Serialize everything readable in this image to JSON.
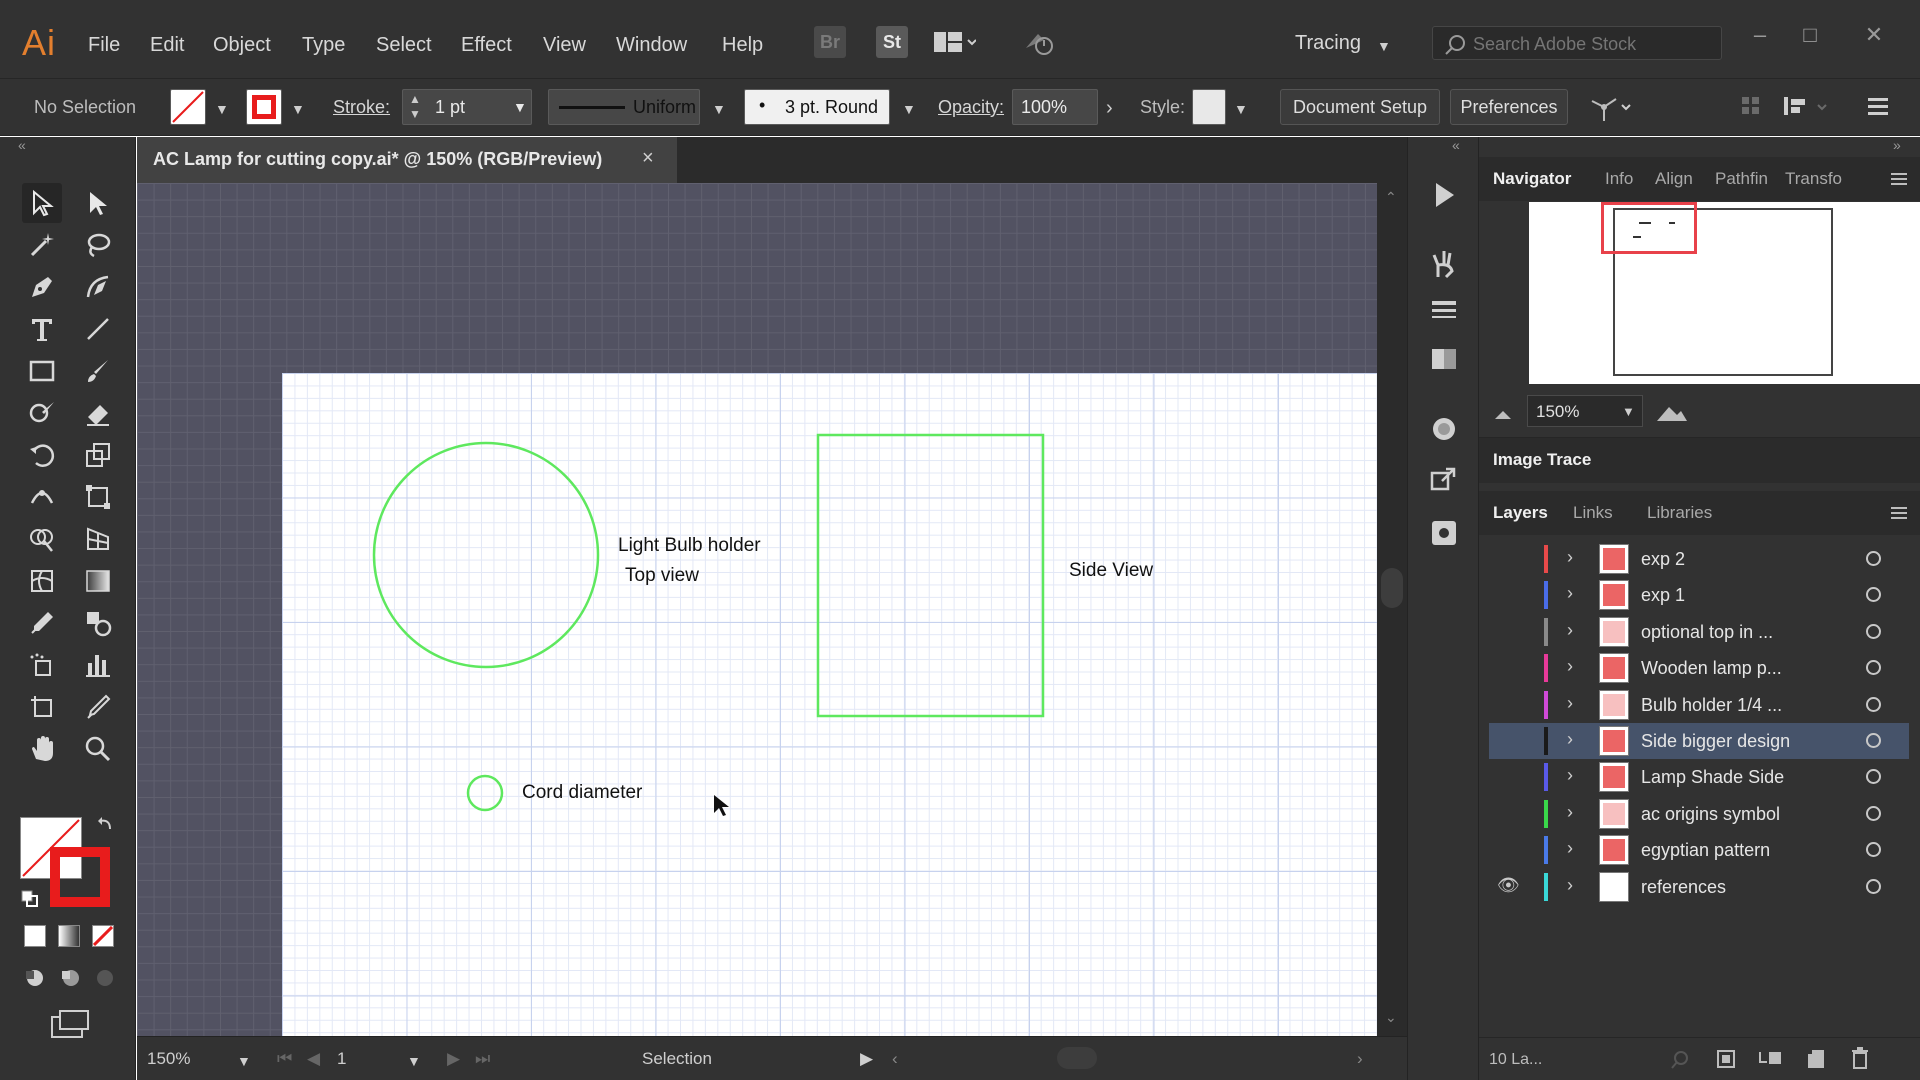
{
  "app": {
    "logo": "Ai"
  },
  "menu": [
    "File",
    "Edit",
    "Object",
    "Type",
    "Select",
    "Effect",
    "View",
    "Window",
    "Help"
  ],
  "menu_icons": {
    "bridge": "Br",
    "stock": "St"
  },
  "workspace": "Tracing",
  "search": {
    "placeholder": "Search Adobe Stock"
  },
  "control": {
    "selection": "No Selection",
    "stroke_label": "Stroke:",
    "stroke_value": "1 pt",
    "profile": "Uniform",
    "brush": "3 pt. Round",
    "opacity_label": "Opacity:",
    "opacity_value": "100%",
    "style_label": "Style:",
    "document_setup": "Document Setup",
    "preferences": "Preferences"
  },
  "document": {
    "title": "AC Lamp for cutting copy.ai* @ 150% (RGB/Preview)",
    "close": "×"
  },
  "artboard": {
    "labels": {
      "bulb_holder": "Light Bulb holder",
      "top_view": "Top view",
      "side_view": "Side View",
      "cord": "Cord diameter"
    },
    "shape_color": "#5ee85e"
  },
  "statusbar": {
    "zoom": "150%",
    "artboard": "1",
    "tool": "Selection"
  },
  "panels": {
    "navigator_tabs": [
      "Navigator",
      "Info",
      "Align",
      "Pathfin",
      "Transfo"
    ],
    "navigator_zoom": "150%",
    "image_trace": "Image Trace",
    "layer_tabs": [
      "Layers",
      "Links",
      "Libraries"
    ],
    "layers_count": "10 La..."
  },
  "layers": [
    {
      "name": "exp 2",
      "color": "#e84a4a"
    },
    {
      "name": "exp 1",
      "color": "#4a6de8"
    },
    {
      "name": "optional top in ...",
      "color": "#8a8a8a"
    },
    {
      "name": "Wooden lamp p...",
      "color": "#e83a9a"
    },
    {
      "name": "Bulb holder 1/4 ...",
      "color": "#d04ad8"
    },
    {
      "name": "Side bigger design",
      "color": "#1a1a1a"
    },
    {
      "name": "Lamp Shade Side",
      "color": "#5a5ae8"
    },
    {
      "name": "ac origins symbol",
      "color": "#3ad84a"
    },
    {
      "name": "egyptian pattern",
      "color": "#4a7ae8"
    },
    {
      "name": "references",
      "color": "#3ad8d8"
    }
  ],
  "colors": {
    "accent_fill_stroke": "#e81c1c",
    "ui_dark": "#323232",
    "selected_row": "#46536a"
  }
}
